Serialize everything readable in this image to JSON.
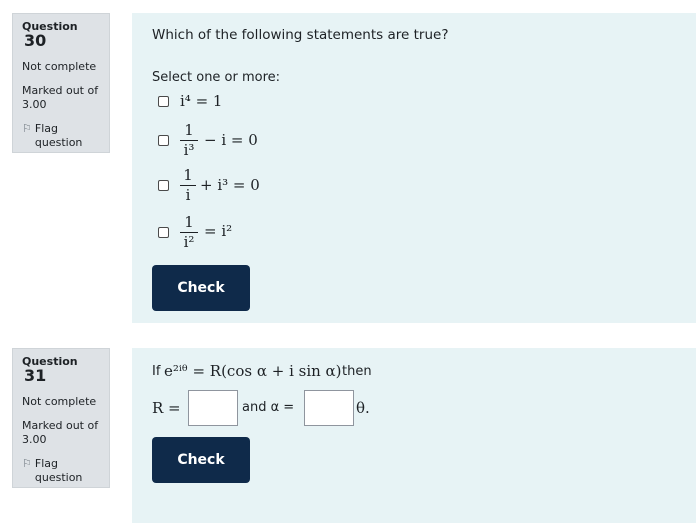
{
  "q30": {
    "label": "Question",
    "number": "30",
    "state": "Not complete",
    "marked_line1": "Marked out of",
    "marked_line2": "3.00",
    "flag_line1": "Flag",
    "flag_line2": "question",
    "question_text": "Which of the following statements are true?",
    "prompt": "Select one or more:",
    "options": [
      {
        "math": "i⁴ = 1"
      },
      {
        "num": "1",
        "den": "i³",
        "rest": "− i = 0"
      },
      {
        "num": "1",
        "den": "i",
        "rest": "+ i³ = 0"
      },
      {
        "num": "1",
        "den": "i²",
        "rest": "= i²"
      }
    ],
    "check_label": "Check"
  },
  "q31": {
    "label": "Question",
    "number": "31",
    "state": "Not complete",
    "marked_line1": "Marked out of",
    "marked_line2": "3.00",
    "flag_line1": "Flag",
    "flag_line2": "question",
    "text_if": "If",
    "equation": "e²ⁱᶿ = R(cos α + i sin α)",
    "text_then": "then",
    "r_label": "R =",
    "and_label": "and α =",
    "theta_label": "θ.",
    "check_label": "Check"
  },
  "icons": {
    "flag": "flag-icon"
  }
}
